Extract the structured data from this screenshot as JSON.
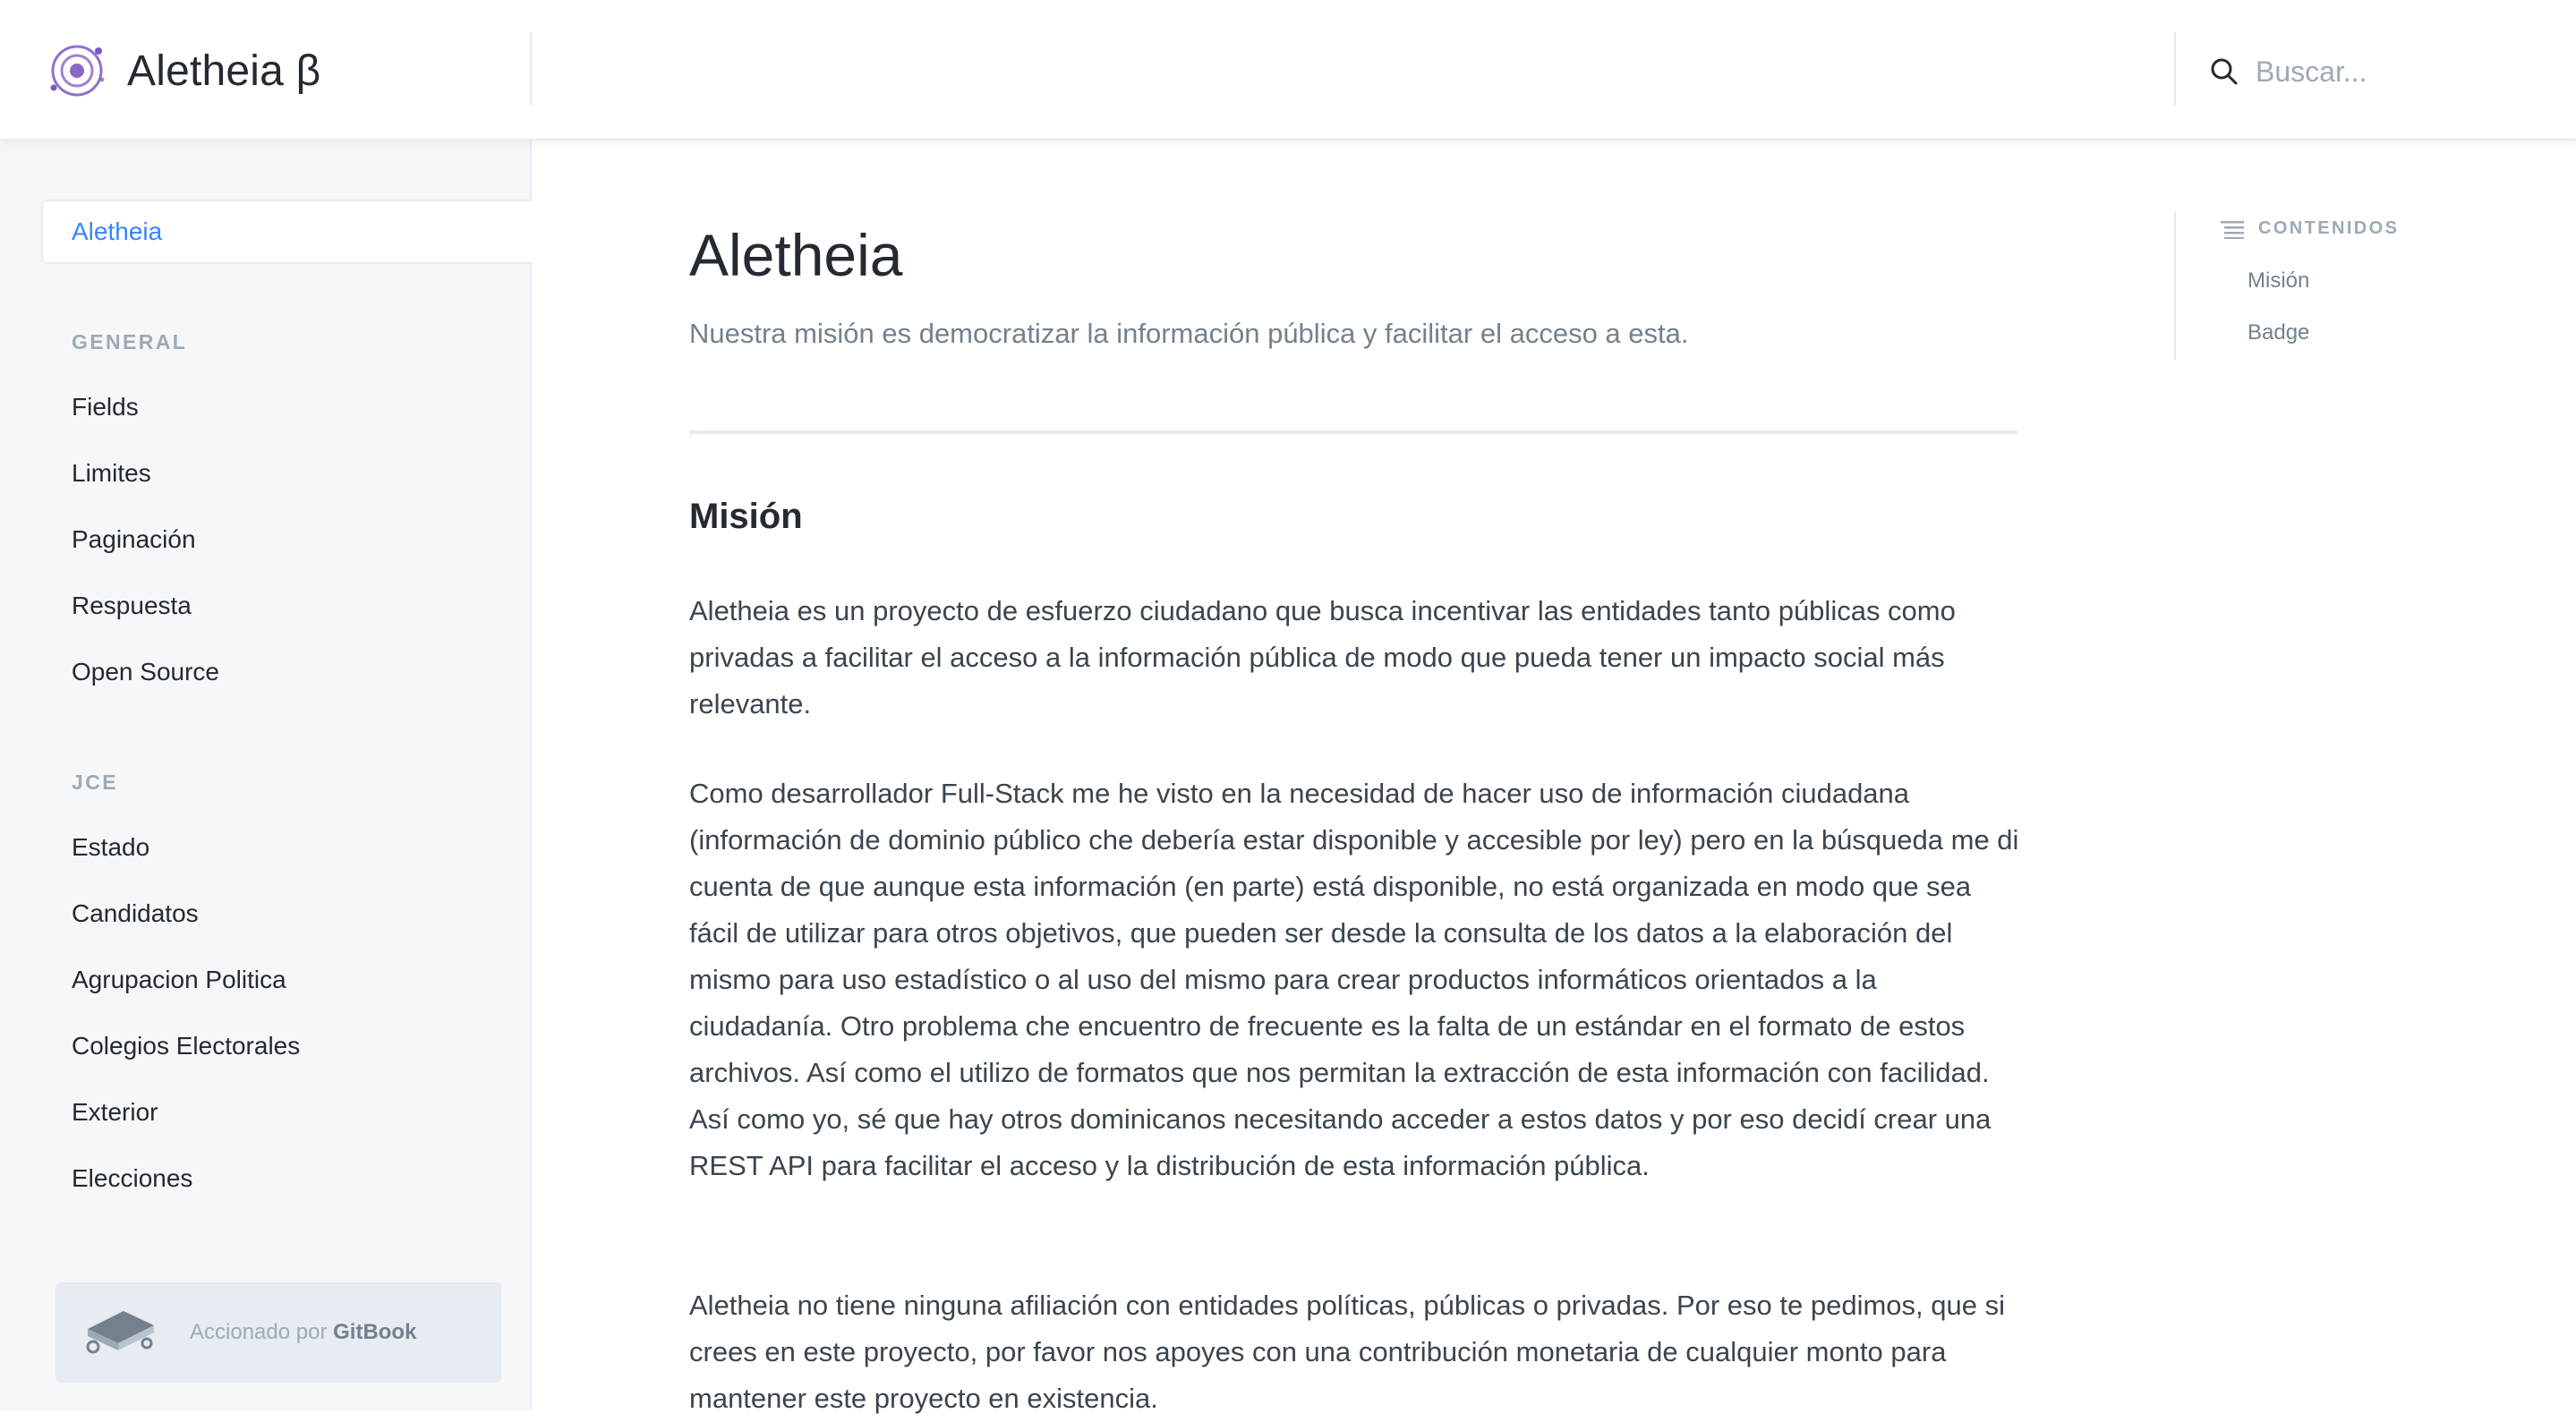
{
  "app": {
    "title": "Aletheia β"
  },
  "search": {
    "placeholder": "Buscar..."
  },
  "sidebar": {
    "active_item": "Aletheia",
    "sections": [
      {
        "title": "GENERAL",
        "items": [
          "Fields",
          "Limites",
          "Paginación",
          "Respuesta",
          "Open Source"
        ]
      },
      {
        "title": "JCE",
        "items": [
          "Estado",
          "Candidatos",
          "Agrupacion Politica",
          "Colegios Electorales",
          "Exterior",
          "Elecciones"
        ]
      }
    ],
    "footer": {
      "prefix": "Accionado por",
      "brand": "GitBook"
    }
  },
  "main": {
    "title": "Aletheia",
    "subtitle": "Nuestra misión es democratizar la información pública y facilitar el acceso a esta.",
    "heading": "Misión",
    "paragraphs": [
      "Aletheia es un proyecto de esfuerzo ciudadano que busca incentivar las entidades tanto públicas como privadas a facilitar el acceso a la información pública de modo que pueda tener un impacto social más relevante.",
      "Como desarrollador Full-Stack me he visto en la necesidad de hacer uso de información ciudadana (información de dominio público che debería estar disponible y accesible por ley) pero en la búsqueda me di cuenta de que aunque esta información (en parte) está disponible, no está organizada en modo que sea fácil de utilizar para otros objetivos, que pueden ser desde la consulta de los datos a la elaboración del mismo para uso estadístico o al uso del mismo para crear productos informáticos orientados a la ciudadanía. Otro problema che encuentro de frecuente es la falta de un estándar en el formato de estos archivos. Así como el utilizo de formatos que nos permitan la extracción de esta información con facilidad. Así como yo, sé que hay otros dominicanos necesitando acceder a estos datos y por eso decidí crear una REST API para facilitar el acceso y la distribución de esta información pública.",
      "Aletheia no tiene ninguna afiliación con entidades políticas, públicas o privadas. Por eso te pedimos, que si crees en este proyecto, por favor nos apoyes con una contribución monetaria de cualquier monto para mantener este proyecto en existencia."
    ]
  },
  "toc": {
    "title": "CONTENIDOS",
    "items": [
      "Misión",
      "Badge"
    ]
  },
  "colors": {
    "accent": "#3884ff",
    "logo": "#7e57c2",
    "sidebar_bg": "#f5f7f9",
    "muted": "#9daab6"
  }
}
